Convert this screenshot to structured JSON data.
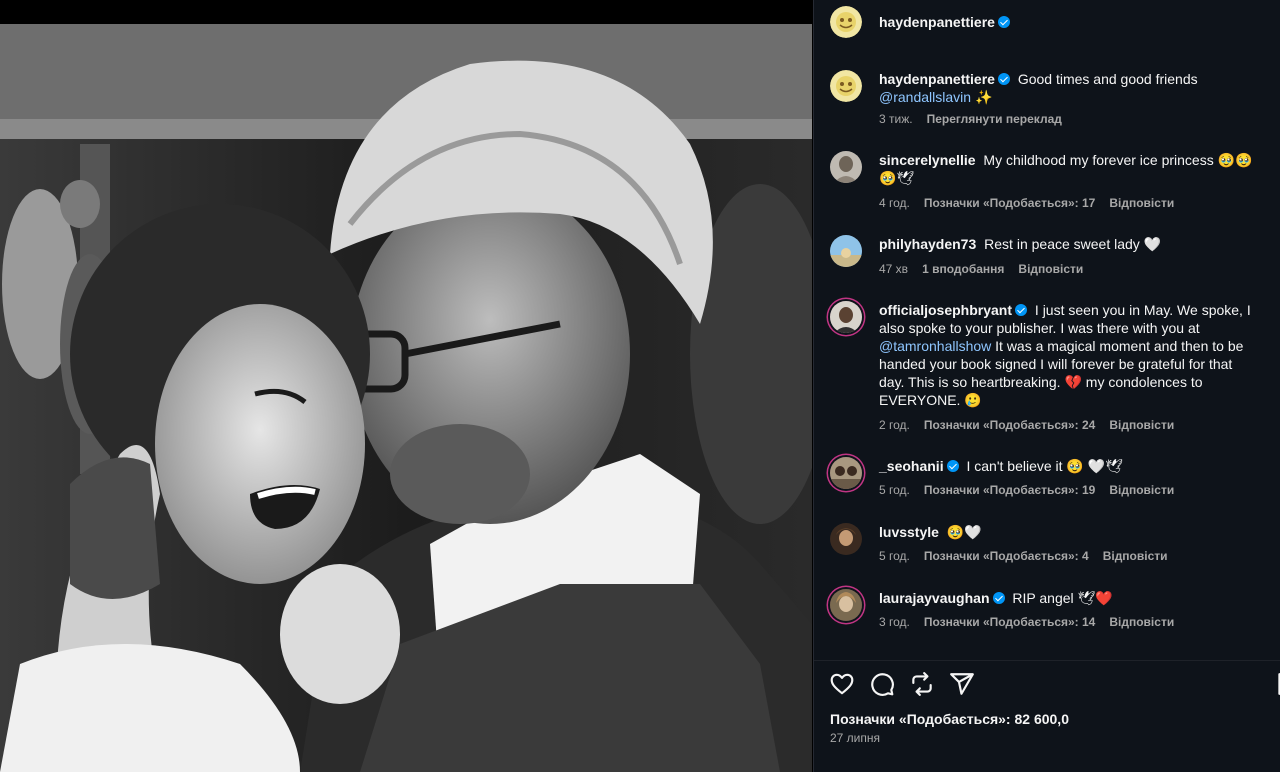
{
  "post": {
    "author": "haydenpanettiere",
    "caption_user": "haydenpanettiere",
    "caption_text": "Good times and good friends",
    "caption_mention": "@randallslavin",
    "caption_emoji": "✨",
    "caption_age": "3 тиж.",
    "translate_label": "Переглянути переклад"
  },
  "comments": [
    {
      "user": "sincerelynellie",
      "verified": false,
      "text": "My childhood my forever ice princess 🥹🥹🥹🕊",
      "age": "4 год.",
      "likes": "Позначки «Подобається»: 17",
      "reply": "Відповісти"
    },
    {
      "user": "philyhayden73",
      "verified": false,
      "text": "Rest in peace sweet lady 🤍",
      "age": "47 хв",
      "likes": "1 вподобання",
      "reply": "Відповісти"
    },
    {
      "user": "officialjosephbryant",
      "verified": true,
      "text_before": "I just seen you in May. We spoke, I also spoke to your publisher. I was there with you at",
      "mention": "@tamronhallshow",
      "text_after": "It was a magical moment and then to be handed your book signed I will forever be grateful for that day. This is so heartbreaking. 💔 my condolences to EVERYONE. 🥲",
      "age": "2 год.",
      "likes": "Позначки «Подобається»: 24",
      "reply": "Відповісти"
    },
    {
      "user": "_seohanii",
      "verified": true,
      "text": "I can't believe it 🥹 🤍🕊",
      "age": "5 год.",
      "likes": "Позначки «Подобається»: 19",
      "reply": "Відповісти"
    },
    {
      "user": "luvsstyle",
      "verified": false,
      "text": "🥹🤍",
      "age": "5 год.",
      "likes": "Позначки «Подобається»: 4",
      "reply": "Відповісти"
    },
    {
      "user": "laurajayvaughan",
      "verified": true,
      "text": "RIP angel 🕊❤️",
      "age": "3 год.",
      "likes": "Позначки «Подобається»: 14",
      "reply": "Відповісти"
    }
  ],
  "footer": {
    "likes": "Позначки «Подобається»: 82 600,0",
    "date": "27 липня"
  },
  "icons": {
    "like": "heart-icon",
    "comment": "comment-icon",
    "share": "repost-icon",
    "send": "send-icon",
    "save": "bookmark-icon"
  }
}
